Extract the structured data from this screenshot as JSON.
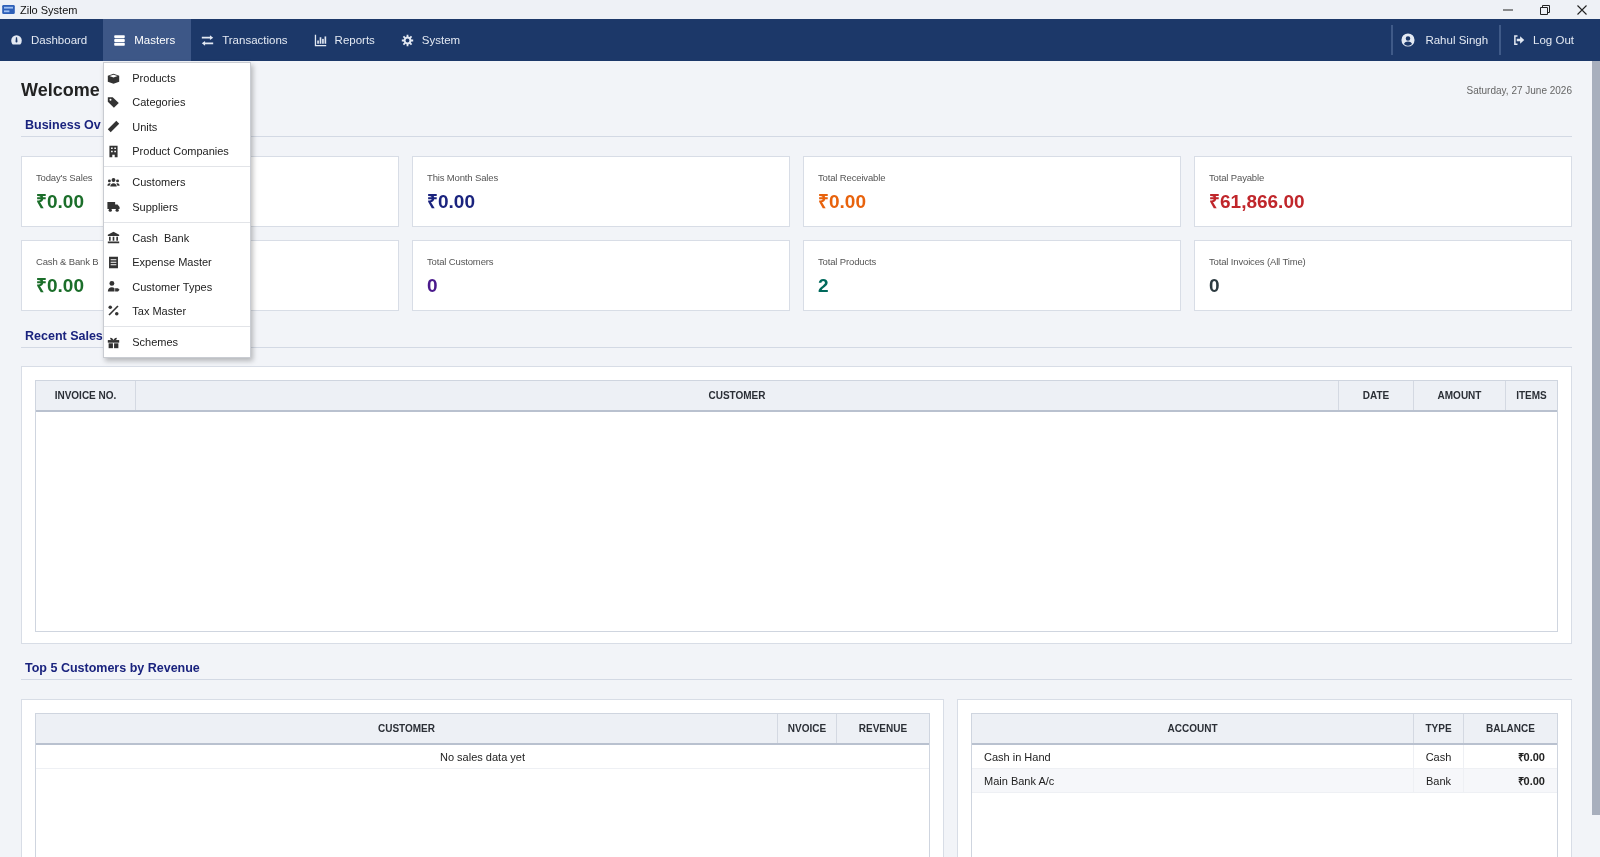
{
  "window": {
    "title": "Zilo System"
  },
  "nav": {
    "items": [
      {
        "label": "Dashboard",
        "selected": false
      },
      {
        "label": "Masters",
        "selected": true,
        "menu": {
          "groups": [
            [
              "Products",
              "Categories",
              "Units",
              "Product Companies"
            ],
            [
              "Customers",
              "Suppliers"
            ],
            [
              "Cash  Bank",
              "Expense Master",
              "Customer Types",
              "Tax Master"
            ],
            [
              "Schemes"
            ]
          ]
        }
      },
      {
        "label": "Transactions",
        "selected": false
      },
      {
        "label": "Reports",
        "selected": false
      },
      {
        "label": "System",
        "selected": false
      }
    ],
    "user": "Rahul Singh",
    "logout": "Log Out"
  },
  "page": {
    "title": "Welcome",
    "date": "Saturday, 27 June 2026"
  },
  "overview": {
    "heading": "Business Ov",
    "cards": [
      {
        "label": "Today's Sales",
        "value": "₹0.00",
        "color": "#1b6e2a"
      },
      {
        "label": "This Month Sales",
        "value": "₹0.00",
        "color": "#1a237e"
      },
      {
        "label": "Total Receivable",
        "value": "₹0.00",
        "color": "#e8620c"
      },
      {
        "label": "Total Payable",
        "value": "₹61,866.00",
        "color": "#c0262b"
      },
      {
        "label": "Cash & Bank B",
        "value": "₹0.00",
        "color": "#1b6e2a"
      },
      {
        "label": "Total Customers",
        "value": "0",
        "color": "#4a1a8c"
      },
      {
        "label": "Total Products",
        "value": "2",
        "color": "#00695c"
      },
      {
        "label": "Total Invoices (All Time)",
        "value": "0",
        "color": "#2c3a40"
      }
    ]
  },
  "recent_sales": {
    "heading": "Recent Sales",
    "columns": [
      "INVOICE NO.",
      "CUSTOMER",
      "DATE",
      "AMOUNT",
      "ITEMS"
    ]
  },
  "top_customers": {
    "heading": "Top 5 Customers by Revenue",
    "columns": [
      "CUSTOMER",
      "NVOICE",
      "REVENUE"
    ],
    "empty_message": "No sales data yet"
  },
  "accounts": {
    "columns": [
      "ACCOUNT",
      "TYPE",
      "BALANCE"
    ],
    "rows": [
      [
        "Cash in Hand",
        "Cash",
        "₹0.00"
      ],
      [
        "Main Bank A/c",
        "Bank",
        "₹0.00"
      ]
    ]
  }
}
